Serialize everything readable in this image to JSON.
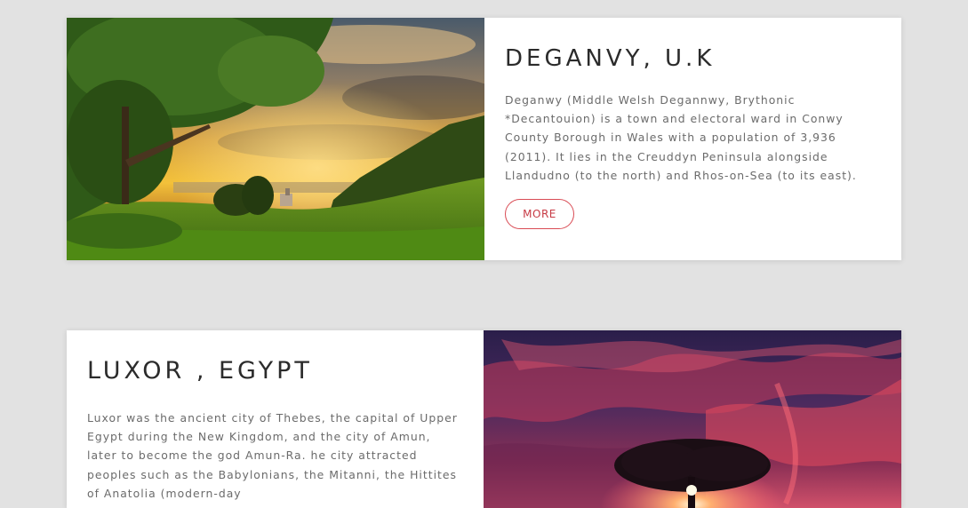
{
  "cards": [
    {
      "title": "DEGANVY, U.K",
      "description": "Deganwy (Middle Welsh Degannwy, Brythonic *Decantouion) is a town and electoral ward in Conwy County Borough in Wales with a population of 3,936 (2011). It lies in the Creuddyn Peninsula alongside Llandudno (to the north) and Rhos-on-Sea (to its east).",
      "button_label": "MORE",
      "image": "sunset-valley-landscape"
    },
    {
      "title": "LUXOR , EGYPT",
      "description": "Luxor was the ancient city of Thebes, the capital of Upper Egypt during the New Kingdom, and the city of Amun, later to become the god Amun-Ra. he city attracted peoples such as the Babylonians, the Mitanni, the Hittites of Anatolia (modern-day",
      "image": "red-sky-tree-silhouette"
    }
  ],
  "colors": {
    "page_background": "#e2e2e2",
    "card_background": "#ffffff",
    "accent": "#d94b54",
    "title": "#2b2b2b",
    "body_text": "#6b6b6b"
  }
}
